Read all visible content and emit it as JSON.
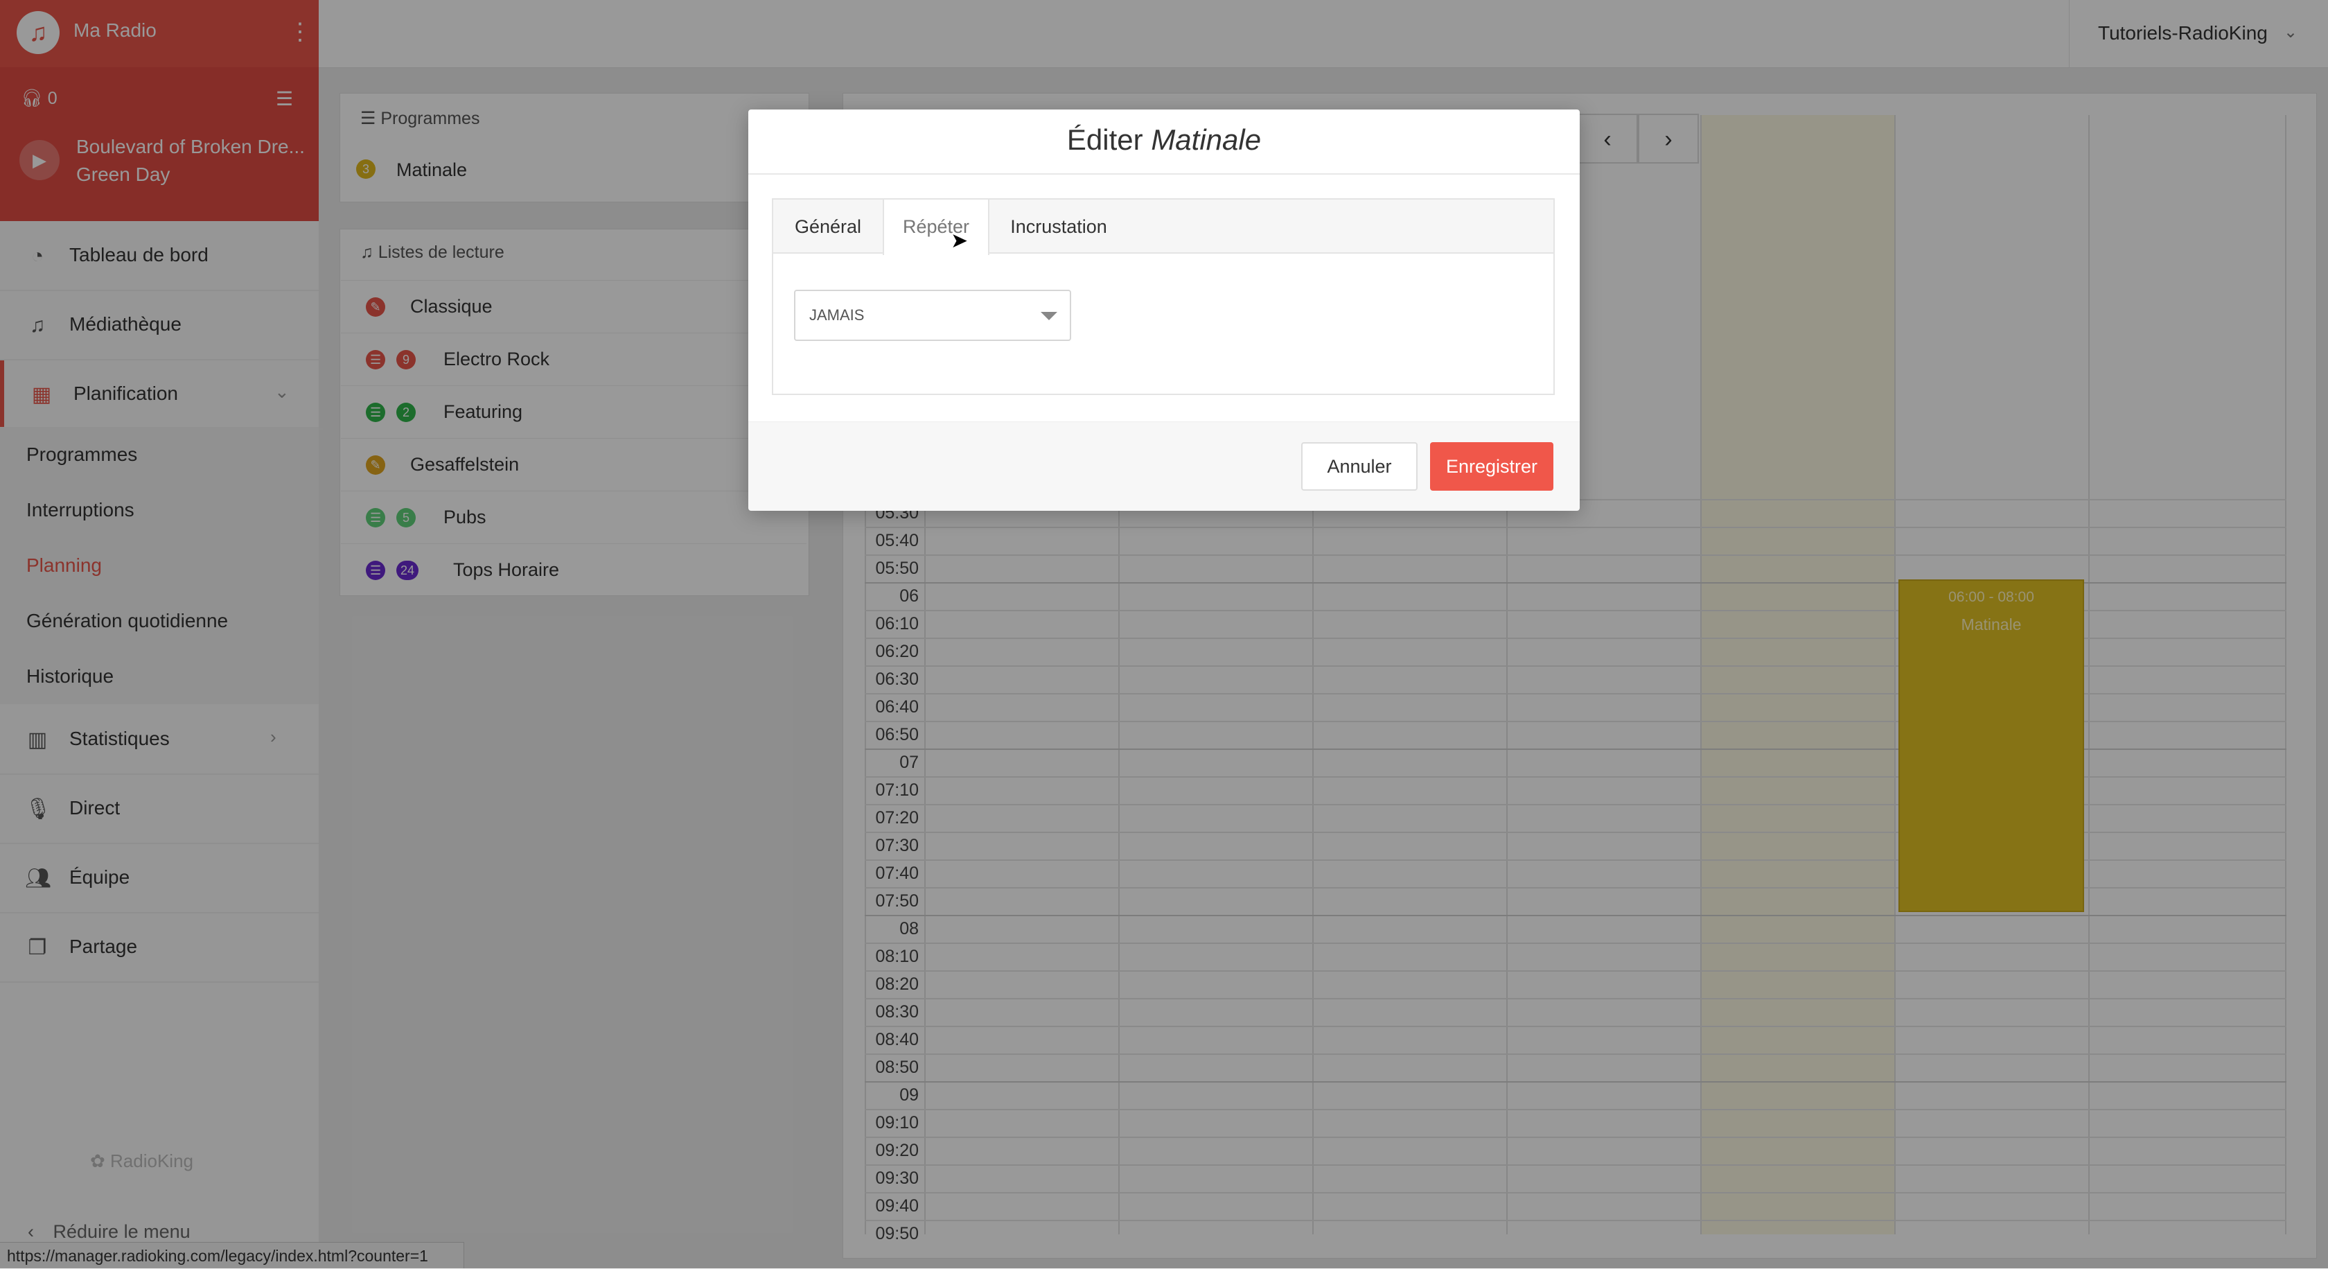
{
  "sidebar": {
    "app_name": "Ma Radio",
    "listeners": "0",
    "now_playing": {
      "track": "Boulevard of Broken Dre...",
      "artist": "Green Day"
    },
    "nav": [
      {
        "label": "Tableau de bord",
        "icon": "dashboard-icon"
      },
      {
        "label": "Médiathèque",
        "icon": "music-note-icon"
      },
      {
        "label": "Planification",
        "icon": "calendar-icon"
      },
      {
        "label": "Statistiques",
        "icon": "bar-chart-icon"
      },
      {
        "label": "Direct",
        "icon": "microphone-icon"
      },
      {
        "label": "Équipe",
        "icon": "team-icon"
      },
      {
        "label": "Partage",
        "icon": "share-icon"
      }
    ],
    "sub_items": [
      {
        "label": "Programmes"
      },
      {
        "label": "Interruptions"
      },
      {
        "label": "Planning"
      },
      {
        "label": "Génération quotidienne"
      },
      {
        "label": "Historique"
      }
    ],
    "brand": "RadioKing",
    "collapse_label": "Réduire le menu"
  },
  "status_url": "https://manager.radioking.com/legacy/index.html?counter=1",
  "topbar": {
    "account": "Tutoriels-RadioKing"
  },
  "programmes": {
    "title": "Programmes",
    "items": [
      {
        "badge": "3",
        "color": "#e0b81e",
        "name": "Matinale"
      }
    ]
  },
  "playlists": {
    "title": "Listes de lecture",
    "items": [
      {
        "name": "Classique",
        "color": "#e8564a",
        "count": ""
      },
      {
        "name": "Electro Rock",
        "color": "#e8564a",
        "count": "9"
      },
      {
        "name": "Featuring",
        "color": "#2fb54a",
        "count": "2"
      },
      {
        "name": "Gesaffelstein",
        "color": "#e0a520",
        "count": ""
      },
      {
        "name": "Pubs",
        "color": "#5fd07a",
        "count": "5"
      },
      {
        "name": "Tops Horaire",
        "color": "#6a2bd0",
        "count": "24"
      }
    ]
  },
  "calendar": {
    "times": [
      "05:30",
      "05:40",
      "05:50",
      "06",
      "06:10",
      "06:20",
      "06:30",
      "06:40",
      "06:50",
      "07",
      "07:10",
      "07:20",
      "07:30",
      "07:40",
      "07:50",
      "08",
      "08:10",
      "08:20",
      "08:30",
      "08:40",
      "08:50",
      "09",
      "09:10",
      "09:20",
      "09:30",
      "09:40",
      "09:50"
    ],
    "event": {
      "time": "06:00 - 08:00",
      "name": "Matinale",
      "color": "#e0c024"
    }
  },
  "modal": {
    "title_prefix": "Éditer ",
    "title_name": "Matinale",
    "tabs": [
      {
        "label": "Général"
      },
      {
        "label": "Répéter"
      },
      {
        "label": "Incrustation"
      }
    ],
    "active_tab": "Répéter",
    "repeat_select": "JAMAIS",
    "cancel_label": "Annuler",
    "save_label": "Enregistrer"
  }
}
